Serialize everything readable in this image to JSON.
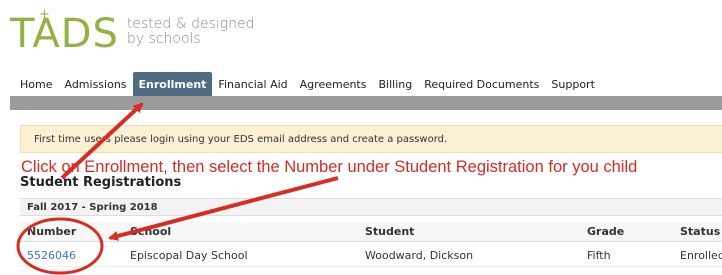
{
  "logo": {
    "mark": "TADS",
    "plus": "+",
    "tagline_line1": "tested & designed",
    "tagline_line2": "by schools"
  },
  "nav": {
    "items": [
      {
        "label": "Home"
      },
      {
        "label": "Admissions"
      },
      {
        "label": "Enrollment",
        "active": true
      },
      {
        "label": "Financial Aid"
      },
      {
        "label": "Agreements"
      },
      {
        "label": "Billing"
      },
      {
        "label": "Required Documents"
      },
      {
        "label": "Support"
      }
    ]
  },
  "alert": {
    "text": "First time users please login using your EDS email address and create a password."
  },
  "annotation": {
    "text": "Click on Enrollment, then select the Number under Student Registration for you child",
    "color": "#d92a23"
  },
  "section": {
    "title": "Student Registrations"
  },
  "table": {
    "term": "Fall 2017 - Spring 2018",
    "headers": {
      "number": "Number",
      "school": "School",
      "student": "Student",
      "grade": "Grade",
      "status": "Status"
    },
    "rows": [
      {
        "number": "5526046",
        "school": "Episcopal Day School",
        "student": "Woodward, Dickson",
        "grade": "Fifth",
        "status": "Enrolled"
      }
    ]
  },
  "colors": {
    "brand_green": "#93b243",
    "nav_active": "#4d6b81",
    "nav_bar": "#9b9b9b",
    "alert_bg": "#fbf0d2",
    "link": "#3a7bbf"
  }
}
